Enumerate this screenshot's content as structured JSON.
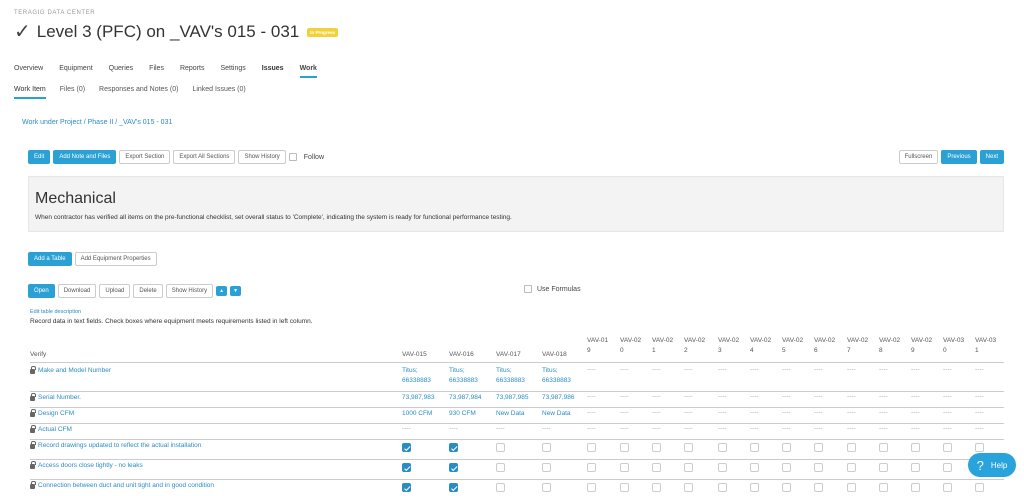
{
  "org": "TERAGIG DATA CENTER",
  "title": "Level 3 (PFC) on _VAV's 015 - 031",
  "badge": "In Progress",
  "main_nav": [
    "Overview",
    "Equipment",
    "Queries",
    "Files",
    "Reports",
    "Settings",
    "Issues",
    "Work"
  ],
  "sub_nav": [
    "Work Item",
    "Files (0)",
    "Responses and Notes (0)",
    "Linked Issues (0)"
  ],
  "breadcrumb": "Work under Project / Phase II / _VAV's 015 - 031",
  "toolbar": {
    "edit": "Edit",
    "add_note": "Add Note and Files",
    "export_section": "Export Section",
    "export_all": "Export All Sections",
    "show_history": "Show History",
    "follow": "Follow",
    "fullscreen": "Fullscreen",
    "previous": "Previous",
    "next": "Next"
  },
  "section": {
    "title": "Mechanical",
    "description": "When contractor has verified all items on the pre-functional checklist, set overall status to 'Complete', indicating the system is ready for functional performance testing."
  },
  "table_tools": {
    "add_table": "Add a Table",
    "add_props": "Add Equipment Properties"
  },
  "row_tools": {
    "open": "Open",
    "download": "Download",
    "upload": "Upload",
    "delete": "Delete",
    "show_history": "Show History",
    "use_formulas": "Use Formulas"
  },
  "edit_desc": "Edit table description",
  "record_note": "Record data in text fields. Check boxes where equipment meets requirements listed in left column.",
  "table": {
    "verify_header": "Verify",
    "columns": [
      "VAV-015",
      "VAV-016",
      "VAV-017",
      "VAV-018",
      "VAV-019",
      "VAV-020",
      "VAV-021",
      "VAV-022",
      "VAV-023",
      "VAV-024",
      "VAV-025",
      "VAV-026",
      "VAV-027",
      "VAV-028",
      "VAV-029",
      "VAV-030",
      "VAV-031"
    ],
    "rows": [
      {
        "label": "Make and Model Number",
        "type": "text",
        "values": [
          "Titus; 66338883",
          "Titus; 66338883",
          "Titus; 66338883",
          "Titus; 66338883"
        ]
      },
      {
        "label": "Serial Number.",
        "type": "text",
        "values": [
          "73,987,983",
          "73,987,984",
          "73,987,985",
          "73,987,986"
        ]
      },
      {
        "label": "Design CFM",
        "type": "text",
        "values": [
          "1000 CFM",
          "930 CFM",
          "New Data",
          "New Data"
        ]
      },
      {
        "label": "Actual CFM",
        "type": "text",
        "values": []
      },
      {
        "label": "Record drawings updated to reflect the actual installation",
        "type": "check",
        "checked": [
          true,
          true
        ]
      },
      {
        "label": "Access doors close tightly - no leaks",
        "type": "check",
        "checked": [
          true,
          true
        ]
      },
      {
        "label": "Connection between duct and unit tight and in good condition",
        "type": "check",
        "checked": [
          true,
          true
        ]
      }
    ],
    "empty_mark": "----"
  },
  "help": "Help"
}
